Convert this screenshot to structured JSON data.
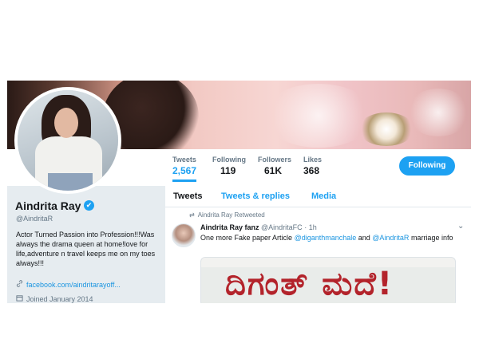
{
  "profile": {
    "name": "Aindrita Ray",
    "verified_glyph": "✔",
    "handle": "@AindritaR",
    "bio": "Actor Turned Passion into Profession!!!Was always the drama queen at home!love for life,adventure n travel keeps me on my toes always!!!",
    "website": "facebook.com/aindritarayoff...",
    "joined": "Joined January 2014",
    "link_icon": "link-icon",
    "calendar_icon": "calendar-icon"
  },
  "stats": [
    {
      "label": "Tweets",
      "value": "2,567"
    },
    {
      "label": "Following",
      "value": "119"
    },
    {
      "label": "Followers",
      "value": "61K"
    },
    {
      "label": "Likes",
      "value": "368"
    }
  ],
  "follow_button": "Following",
  "tabs": [
    "Tweets",
    "Tweets & replies",
    "Media"
  ],
  "tweet": {
    "retweet_note": "Aindrita Ray Retweeted",
    "author_name": "Aindrita Ray fanz",
    "author_handle": "@AindritaFC",
    "time": "· 1h",
    "text_before": "One more Fake paper Article ",
    "mention1": "@diganthmanchale",
    "text_mid": " and ",
    "mention2": "@AindritaR",
    "text_after": " marriage info",
    "image_text": "ದಿಗಂತ್ ಮದೆ!"
  },
  "colors": {
    "accent": "#1da1f2",
    "link": "#1b95e0",
    "muted": "#657786",
    "headline_red": "#b3232b"
  }
}
